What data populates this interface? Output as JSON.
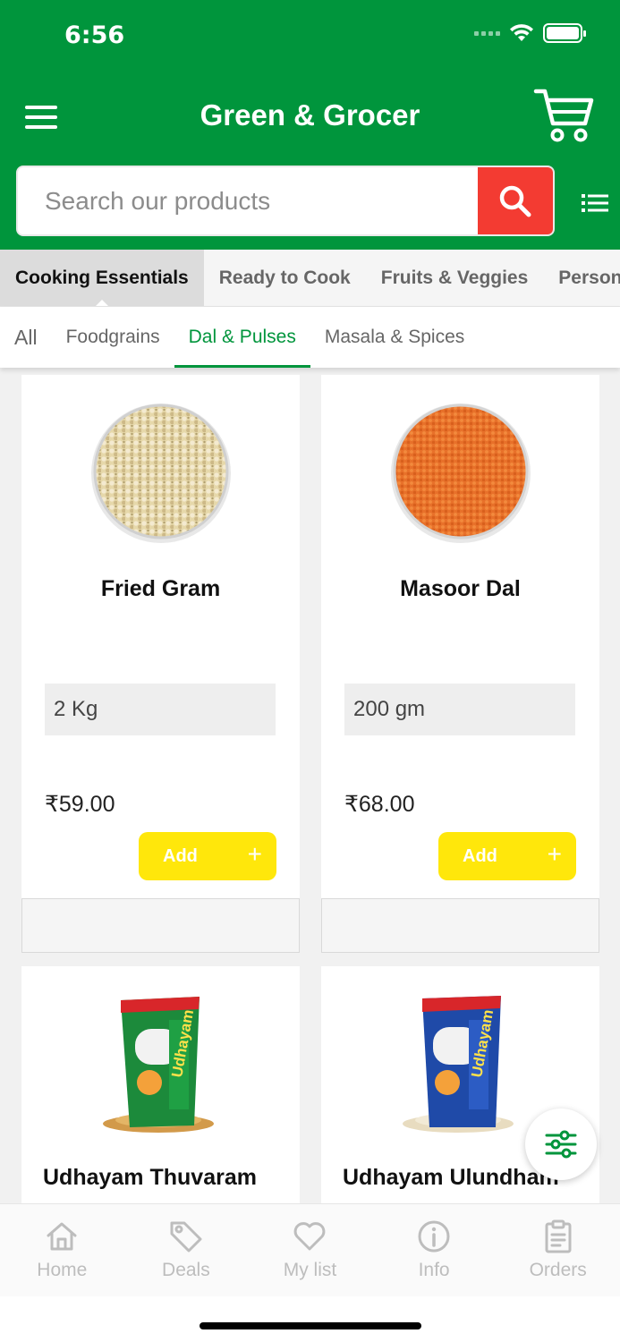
{
  "status_bar": {
    "time": "6:56"
  },
  "header": {
    "title": "Green & Grocer"
  },
  "search": {
    "placeholder": "Search our products"
  },
  "category_tabs": [
    {
      "label": "Cooking Essentials",
      "active": true
    },
    {
      "label": "Ready to Cook",
      "active": false
    },
    {
      "label": "Fruits & Veggies",
      "active": false
    },
    {
      "label": "Personal",
      "active": false
    }
  ],
  "sub_tabs": [
    {
      "label": "All",
      "active": false
    },
    {
      "label": "Foodgrains",
      "active": false
    },
    {
      "label": "Dal & Pulses",
      "active": true
    },
    {
      "label": "Masala & Spices",
      "active": false
    }
  ],
  "products": [
    {
      "name": "Fried Gram",
      "variant": "2 Kg",
      "price": "₹59.00",
      "add_label": "Add",
      "add_icon": "+",
      "image": "fried-gram-bowl"
    },
    {
      "name": "Masoor Dal",
      "variant": "200 gm",
      "price": "₹68.00",
      "add_label": "Add",
      "add_icon": "+",
      "image": "masoor-dal-bowl"
    },
    {
      "name": "Udhayam Thuvaram",
      "image": "udhayam-green-pack"
    },
    {
      "name": "Udhayam Ulundham",
      "image": "udhayam-blue-pack"
    }
  ],
  "bottom_nav": [
    {
      "label": "Home",
      "icon": "home-icon"
    },
    {
      "label": "Deals",
      "icon": "tag-icon"
    },
    {
      "label": "My list",
      "icon": "heart-icon"
    },
    {
      "label": "Info",
      "icon": "info-icon"
    },
    {
      "label": "Orders",
      "icon": "clipboard-icon"
    }
  ],
  "colors": {
    "brand_green": "#00953c",
    "search_red": "#f33b32",
    "add_yellow": "#ffe70b",
    "nav_gray": "#bdbdbd"
  }
}
